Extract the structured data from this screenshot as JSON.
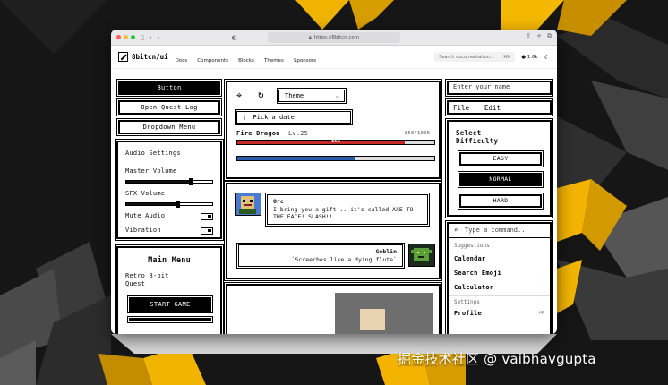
{
  "browser": {
    "url": "https://8bitcn.com",
    "traffic_colors": [
      "#ff5f57",
      "#febc2e",
      "#28c840"
    ]
  },
  "site": {
    "brand": "8bitcn/ui",
    "nav": [
      "Docs",
      "Components",
      "Blocks",
      "Themes",
      "Sponsors"
    ],
    "search_placeholder": "Search documentation...",
    "search_shortcut": "⌘K",
    "github_stars": "1.6k"
  },
  "left": {
    "buttons": [
      "Button",
      "Open Quest Log",
      "Dropdown Menu"
    ],
    "audio": {
      "title": "Audio Settings",
      "master_label": "Master Volume",
      "master_level": 0.75,
      "sfx_label": "SFX Volume",
      "sfx_level": 0.6,
      "mute_label": "Mute Audio",
      "vibration_label": "Vibration"
    },
    "menu": {
      "title": "Main Menu",
      "subtitle": "Retro 8-bit Quest",
      "start": "START GAME"
    }
  },
  "middle": {
    "theme_select": "Theme",
    "date_placeholder": "Pick a date",
    "health": {
      "name": "Fire Dragon",
      "level": "Lv.25",
      "hp": "850/1000",
      "percent_label": "85%",
      "fraction": 0.85,
      "mana_fraction": 0.6
    },
    "chat": [
      {
        "who": "Orc",
        "text": "I bring you a gift... it's called AXE TO THE FACE! SLASH!!"
      },
      {
        "who": "Goblin",
        "text": "`Screeches like a dying flute`"
      }
    ]
  },
  "right": {
    "name_placeholder": "Enter your name",
    "menubar": [
      "File",
      "Edit"
    ],
    "difficulty": {
      "title": "Select Difficulty",
      "options": [
        "EASY",
        "NORMAL",
        "HARD"
      ],
      "selected": "NORMAL"
    },
    "command": {
      "placeholder": "Type a command...",
      "suggestions_head": "Suggestions",
      "suggestions": [
        "Calendar",
        "Search Emoji",
        "Calculator"
      ],
      "settings_head": "Settings",
      "settings": [
        "Profile"
      ]
    }
  },
  "watermark": "掘金技术社区 @ vaibhavgupta"
}
